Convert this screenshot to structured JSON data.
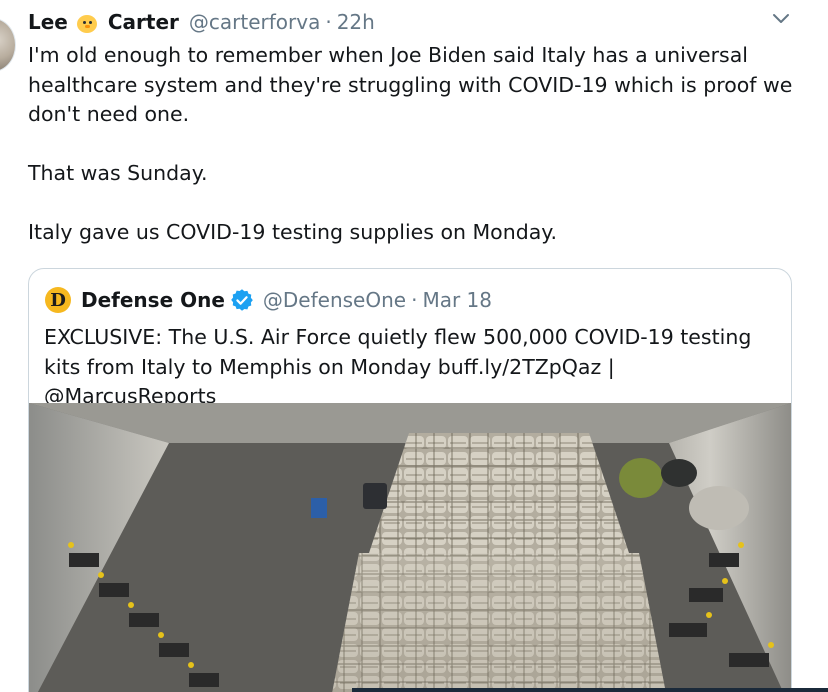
{
  "tweet": {
    "author_first": "Lee",
    "author_emoji": "chick-icon",
    "author_last": "Carter",
    "handle": "@carterforva",
    "separator": "·",
    "time": "22h",
    "menu_icon": "chevron-down-icon",
    "paragraphs": [
      "I'm old enough to remember when Joe Biden said Italy has a universal healthcare system and they're struggling with COVID-19 which is proof we don't need one.",
      "That was Sunday.",
      "Italy gave us COVID-19 testing supplies on Monday."
    ]
  },
  "quoted_tweet": {
    "avatar_letter": "D",
    "name": "Defense One",
    "verified_icon": "verified-badge-icon",
    "handle": "@DefenseOne",
    "separator": "·",
    "time": "Mar 18",
    "text": "EXCLUSIVE: The U.S. Air Force quietly flew 500,000 COVID-19 testing kits from Italy to Memphis on Monday buff.ly/2TZpQaz | @MarcusReports",
    "image": "cargo-plane-interior-photo"
  },
  "colors": {
    "text": "#14171a",
    "muted": "#657786",
    "border": "#ccd6dd",
    "verified": "#1da1f2",
    "defense_one_logo": "#f6b81f"
  }
}
